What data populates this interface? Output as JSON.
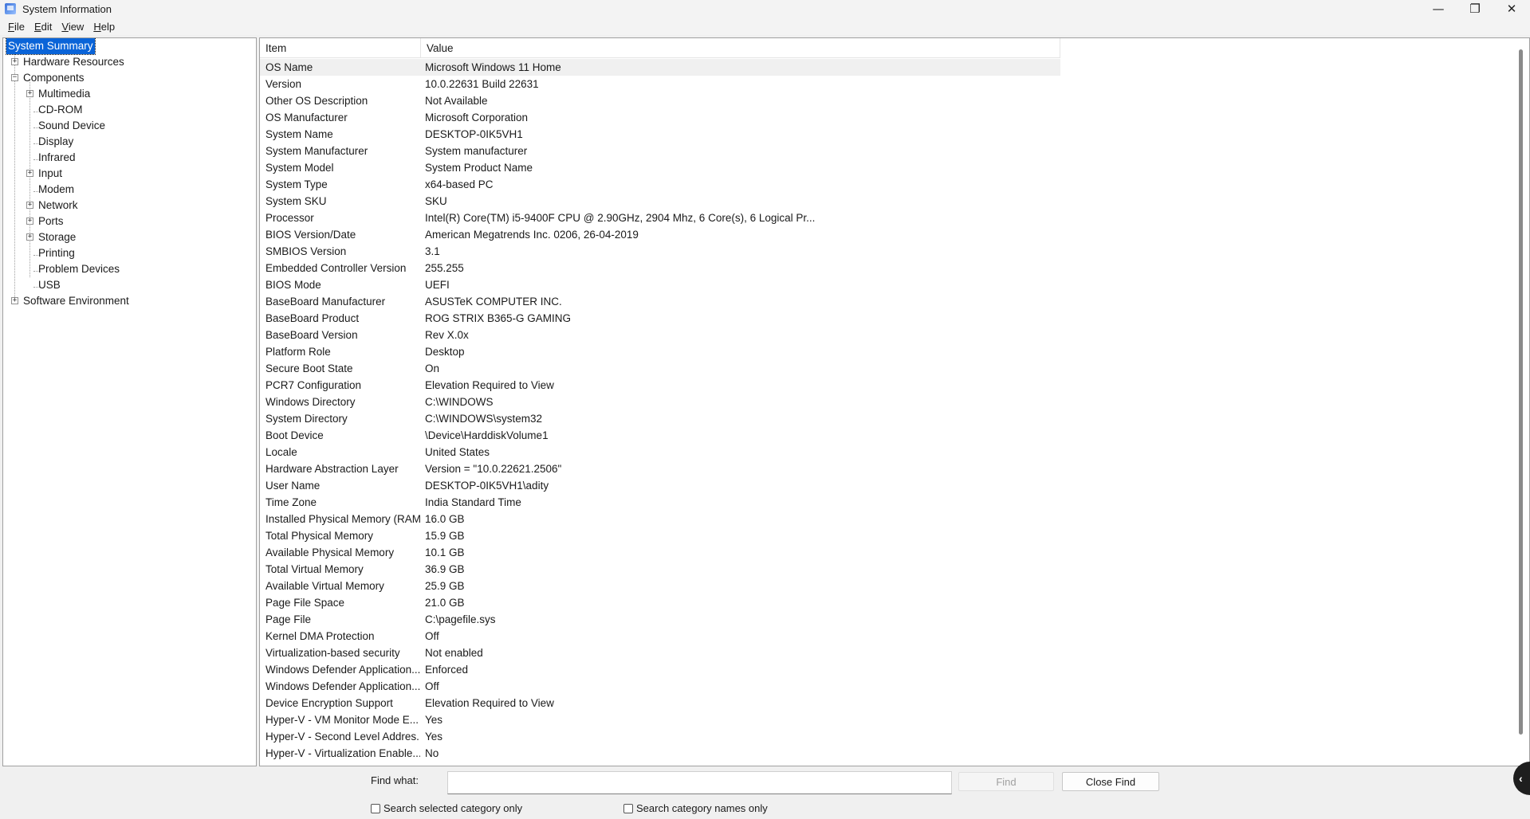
{
  "window": {
    "title": "System Information",
    "controls": {
      "minimize": "—",
      "restore": "❐",
      "close": "✕"
    }
  },
  "menu": [
    {
      "key": "F",
      "rest": "ile"
    },
    {
      "key": "E",
      "rest": "dit"
    },
    {
      "key": "V",
      "rest": "iew"
    },
    {
      "key": "H",
      "rest": "elp"
    }
  ],
  "tree": {
    "system_summary": "System Summary",
    "hardware_resources": "Hardware Resources",
    "components": "Components",
    "multimedia": "Multimedia",
    "cdrom": "CD-ROM",
    "sound_device": "Sound Device",
    "display": "Display",
    "infrared": "Infrared",
    "input": "Input",
    "modem": "Modem",
    "network": "Network",
    "ports": "Ports",
    "storage": "Storage",
    "printing": "Printing",
    "problem_devices": "Problem Devices",
    "usb": "USB",
    "software_environment": "Software Environment",
    "expand_glyph": "+",
    "collapse_glyph": "−"
  },
  "table": {
    "headers": {
      "item": "Item",
      "value": "Value"
    },
    "rows": [
      {
        "item": "OS Name",
        "value": "Microsoft Windows 11 Home"
      },
      {
        "item": "Version",
        "value": "10.0.22631 Build 22631"
      },
      {
        "item": "Other OS Description",
        "value": "Not Available"
      },
      {
        "item": "OS Manufacturer",
        "value": "Microsoft Corporation"
      },
      {
        "item": "System Name",
        "value": "DESKTOP-0IK5VH1"
      },
      {
        "item": "System Manufacturer",
        "value": "System manufacturer"
      },
      {
        "item": "System Model",
        "value": "System Product Name"
      },
      {
        "item": "System Type",
        "value": "x64-based PC"
      },
      {
        "item": "System SKU",
        "value": "SKU"
      },
      {
        "item": "Processor",
        "value": "Intel(R) Core(TM) i5-9400F CPU @ 2.90GHz, 2904 Mhz, 6 Core(s), 6 Logical Pr..."
      },
      {
        "item": "BIOS Version/Date",
        "value": "American Megatrends Inc. 0206, 26-04-2019"
      },
      {
        "item": "SMBIOS Version",
        "value": "3.1"
      },
      {
        "item": "Embedded Controller Version",
        "value": "255.255"
      },
      {
        "item": "BIOS Mode",
        "value": "UEFI"
      },
      {
        "item": "BaseBoard Manufacturer",
        "value": "ASUSTeK COMPUTER INC."
      },
      {
        "item": "BaseBoard Product",
        "value": "ROG STRIX B365-G GAMING"
      },
      {
        "item": "BaseBoard Version",
        "value": "Rev X.0x"
      },
      {
        "item": "Platform Role",
        "value": "Desktop"
      },
      {
        "item": "Secure Boot State",
        "value": "On"
      },
      {
        "item": "PCR7 Configuration",
        "value": "Elevation Required to View"
      },
      {
        "item": "Windows Directory",
        "value": "C:\\WINDOWS"
      },
      {
        "item": "System Directory",
        "value": "C:\\WINDOWS\\system32"
      },
      {
        "item": "Boot Device",
        "value": "\\Device\\HarddiskVolume1"
      },
      {
        "item": "Locale",
        "value": "United States"
      },
      {
        "item": "Hardware Abstraction Layer",
        "value": "Version = \"10.0.22621.2506\""
      },
      {
        "item": "User Name",
        "value": "DESKTOP-0IK5VH1\\adity"
      },
      {
        "item": "Time Zone",
        "value": "India Standard Time"
      },
      {
        "item": "Installed Physical Memory (RAM)",
        "value": "16.0 GB"
      },
      {
        "item": "Total Physical Memory",
        "value": "15.9 GB"
      },
      {
        "item": "Available Physical Memory",
        "value": "10.1 GB"
      },
      {
        "item": "Total Virtual Memory",
        "value": "36.9 GB"
      },
      {
        "item": "Available Virtual Memory",
        "value": "25.9 GB"
      },
      {
        "item": "Page File Space",
        "value": "21.0 GB"
      },
      {
        "item": "Page File",
        "value": "C:\\pagefile.sys"
      },
      {
        "item": "Kernel DMA Protection",
        "value": "Off"
      },
      {
        "item": "Virtualization-based security",
        "value": "Not enabled"
      },
      {
        "item": "Windows Defender Application...",
        "value": "Enforced"
      },
      {
        "item": "Windows Defender Application...",
        "value": "Off"
      },
      {
        "item": "Device Encryption Support",
        "value": "Elevation Required to View"
      },
      {
        "item": "Hyper-V - VM Monitor Mode E...",
        "value": "Yes"
      },
      {
        "item": "Hyper-V - Second Level Addres...",
        "value": "Yes"
      },
      {
        "item": "Hyper-V - Virtualization Enable...",
        "value": "No"
      }
    ]
  },
  "find": {
    "label": "Find what:",
    "input_value": "",
    "find_button": "Find",
    "close_find_button": "Close Find",
    "search_selected_category": "Search selected category only",
    "search_category_names": "Search category names only"
  },
  "colors": {
    "selection": "#0a64d8",
    "first_row_bg": "#f0f0f0",
    "window_bg": "#f0f0f0"
  }
}
